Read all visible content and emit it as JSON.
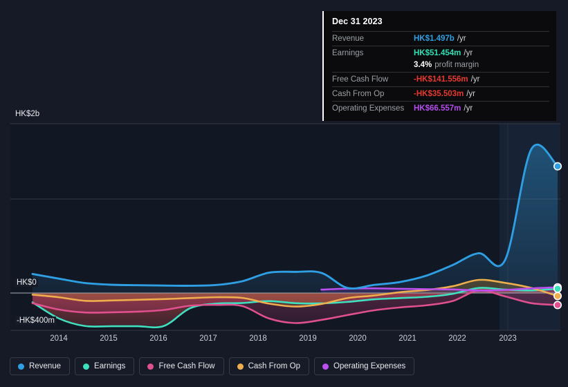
{
  "tooltip": {
    "date": "Dec 31 2023",
    "rows": [
      {
        "label": "Revenue",
        "value": "HK$1.497b",
        "unit": "/yr",
        "color": "#2f9fe3"
      },
      {
        "label": "Earnings",
        "value": "HK$51.454m",
        "unit": "/yr",
        "color": "#2ee0b4"
      },
      {
        "label": "",
        "value": "3.4%",
        "unit": "profit margin",
        "color": "#ffffff"
      },
      {
        "label": "Free Cash Flow",
        "value": "-HK$141.556m",
        "unit": "/yr",
        "color": "#e8392f"
      },
      {
        "label": "Cash From Op",
        "value": "-HK$35.503m",
        "unit": "/yr",
        "color": "#e8392f"
      },
      {
        "label": "Operating Expenses",
        "value": "HK$66.557m",
        "unit": "/yr",
        "color": "#b44cf0"
      }
    ]
  },
  "axes": {
    "y_labels": [
      "HK$2b",
      "HK$0",
      "-HK$400m"
    ],
    "x_labels": [
      "2014",
      "2015",
      "2016",
      "2017",
      "2018",
      "2019",
      "2020",
      "2021",
      "2022",
      "2023"
    ]
  },
  "legend": [
    {
      "label": "Revenue",
      "color": "#2f9fe3"
    },
    {
      "label": "Earnings",
      "color": "#3fe0c0"
    },
    {
      "label": "Free Cash Flow",
      "color": "#e0508f"
    },
    {
      "label": "Cash From Op",
      "color": "#eeae4e"
    },
    {
      "label": "Operating Expenses",
      "color": "#bb4ff0"
    }
  ],
  "colors": {
    "background": "#151a26",
    "plot_background": "#121724",
    "grid": "#333a47",
    "zero_line": "#9aa0a6",
    "forecast_band": "#1b2738"
  },
  "chart_data": {
    "type": "area",
    "title": "",
    "xlabel": "",
    "ylabel": "",
    "ylim": [
      -400,
      2000
    ],
    "y_ticks": [
      2000,
      1000,
      0,
      -400
    ],
    "y_tick_labels": [
      "HK$2b",
      "",
      "HK$0",
      "-HK$400m"
    ],
    "x": [
      "2013.5",
      "2014",
      "2014.5",
      "2015",
      "2015.5",
      "2016",
      "2016.5",
      "2017",
      "2017.5",
      "2018",
      "2018.5",
      "2019",
      "2019.5",
      "2020",
      "2020.5",
      "2021",
      "2021.5",
      "2022",
      "2022.5",
      "2023",
      "2023.9"
    ],
    "categories": [
      "2014",
      "2015",
      "2016",
      "2017",
      "2018",
      "2019",
      "2020",
      "2021",
      "2022",
      "2023"
    ],
    "units": "HK$ millions",
    "grid": true,
    "legend_position": "bottom",
    "forecast_region_start": "2023",
    "series": [
      {
        "name": "Revenue",
        "color": "#2f9fe3",
        "values": [
          225,
          170,
          118,
          98,
          92,
          88,
          86,
          95,
          140,
          240,
          250,
          238,
          60,
          95,
          130,
          205,
          330,
          470,
          390,
          1700,
          1497
        ]
      },
      {
        "name": "Earnings",
        "color": "#3fe0c0",
        "values": [
          -110,
          -300,
          -390,
          -392,
          -392,
          -390,
          -180,
          -125,
          -118,
          -95,
          -120,
          -122,
          -105,
          -75,
          -60,
          -45,
          -10,
          60,
          40,
          30,
          51
        ]
      },
      {
        "name": "Free Cash Flow",
        "color": "#e0508f",
        "values": [
          -120,
          -195,
          -230,
          -228,
          -220,
          -200,
          -150,
          -140,
          -155,
          -300,
          -355,
          -318,
          -260,
          -205,
          -170,
          -145,
          -95,
          30,
          -40,
          -120,
          -142
        ]
      },
      {
        "name": "Cash From Op",
        "color": "#eeae4e",
        "values": [
          -20,
          -50,
          -92,
          -88,
          -80,
          -72,
          -60,
          -50,
          -58,
          -125,
          -160,
          -130,
          -60,
          -30,
          10,
          35,
          80,
          155,
          120,
          60,
          -36
        ]
      },
      {
        "name": "Operating Expenses",
        "color": "#bb4ff0",
        "values": [
          null,
          null,
          null,
          null,
          null,
          null,
          null,
          null,
          null,
          null,
          null,
          40,
          52,
          55,
          50,
          46,
          42,
          30,
          36,
          55,
          67
        ]
      }
    ],
    "endpoint_markers": [
      {
        "series": "Revenue",
        "value": 1497
      },
      {
        "series": "Operating Expenses",
        "value": 67
      },
      {
        "series": "Cash From Op",
        "value": -36
      },
      {
        "series": "Free Cash Flow",
        "value": -142
      },
      {
        "series": "Earnings",
        "value": 51
      }
    ]
  }
}
